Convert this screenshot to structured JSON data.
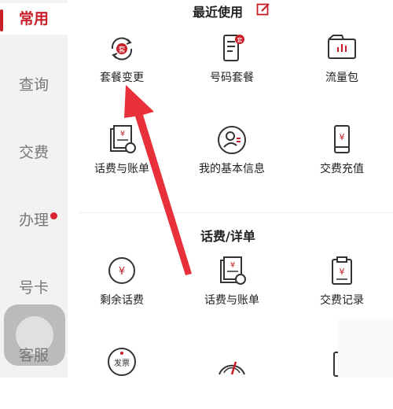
{
  "sidebar": {
    "items": [
      {
        "label": "常用",
        "active": true
      },
      {
        "label": "查询"
      },
      {
        "label": "交费"
      },
      {
        "label": "办理",
        "badge": true
      },
      {
        "label": "号卡"
      },
      {
        "label": "客服"
      }
    ]
  },
  "recent": {
    "title": "最近使用",
    "items": [
      {
        "label": "套餐变更",
        "icon": "package-change-icon",
        "icon_text": "套"
      },
      {
        "label": "号码套餐",
        "icon": "phone-plan-icon",
        "icon_text": "套"
      },
      {
        "label": "流量包",
        "icon": "data-package-icon"
      },
      {
        "label": "话费与账单",
        "icon": "bill-icon",
        "icon_text": "¥"
      },
      {
        "label": "我的基本信息",
        "icon": "profile-icon"
      },
      {
        "label": "交费充值",
        "icon": "recharge-icon",
        "icon_text": "¥"
      }
    ]
  },
  "billing": {
    "title": "话费/详单",
    "items": [
      {
        "label": "剩余话费",
        "icon": "balance-icon",
        "icon_text": "¥"
      },
      {
        "label": "话费与账单",
        "icon": "bill-icon",
        "icon_text": "¥"
      },
      {
        "label": "交费记录",
        "icon": "payment-record-icon",
        "icon_text": "¥"
      },
      {
        "label": "",
        "icon": "invoice-icon",
        "icon_text": "发票"
      },
      {
        "label": "",
        "icon": "speed-gauge-icon"
      },
      {
        "label": "",
        "icon": "call-record-icon"
      }
    ]
  },
  "colors": {
    "accent": "#c81e28",
    "text": "#222222",
    "sidebar_bg": "#f2f2f2"
  }
}
